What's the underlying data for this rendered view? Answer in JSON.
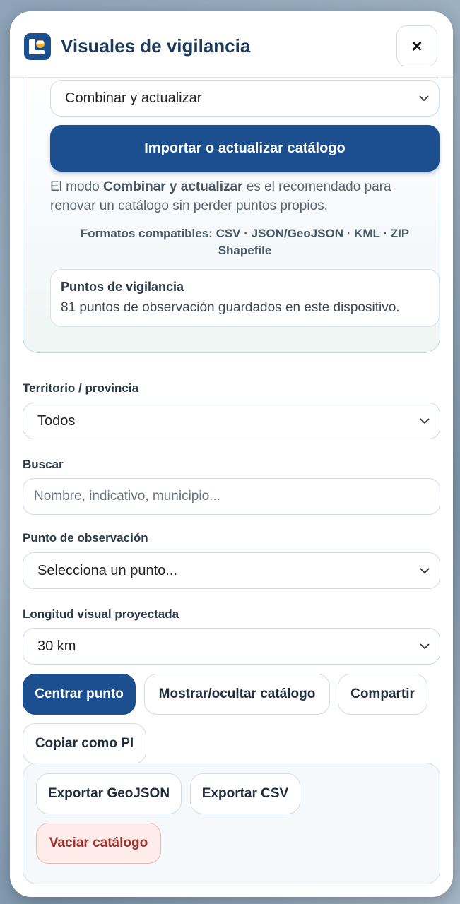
{
  "header": {
    "title": "Visuales de vigilancia",
    "close_label": "×"
  },
  "import": {
    "mode_selected": "Combinar y actualizar",
    "import_button": "Importar o actualizar catálogo",
    "help_prefix": "El modo ",
    "help_bold": "Combinar y actualizar",
    "help_suffix": " es el recomendado para renovar un catálogo sin perder puntos propios.",
    "formats_line1": "Formatos compatibles: CSV · JSON/GeoJSON · KML · ZIP",
    "formats_line2": "Shapefile",
    "points_title": "Puntos de vigilancia",
    "points_text": "81 puntos de observación guardados en este dispositivo."
  },
  "filters": {
    "territory_label": "Territorio / provincia",
    "territory_value": "Todos",
    "search_label": "Buscar",
    "search_placeholder": "Nombre, indicativo, municipio...",
    "point_label": "Punto de observación",
    "point_value": "Selecciona un punto...",
    "length_label": "Longitud visual proyectada",
    "length_value": "30 km"
  },
  "actions": {
    "center": "Centrar punto",
    "toggle_catalog": "Mostrar/ocultar catálogo",
    "share": "Compartir",
    "copy_pi": "Copiar como PI"
  },
  "export": {
    "geojson": "Exportar GeoJSON",
    "csv": "Exportar CSV",
    "clear": "Vaciar catálogo"
  },
  "colors": {
    "primary": "#1c4f8f",
    "danger_text": "#a2302a",
    "danger_bg": "#fdecea"
  },
  "icons": {
    "logo": "binoculars-app-icon",
    "close": "close-icon",
    "dropdown": "chevron-down-icon"
  }
}
